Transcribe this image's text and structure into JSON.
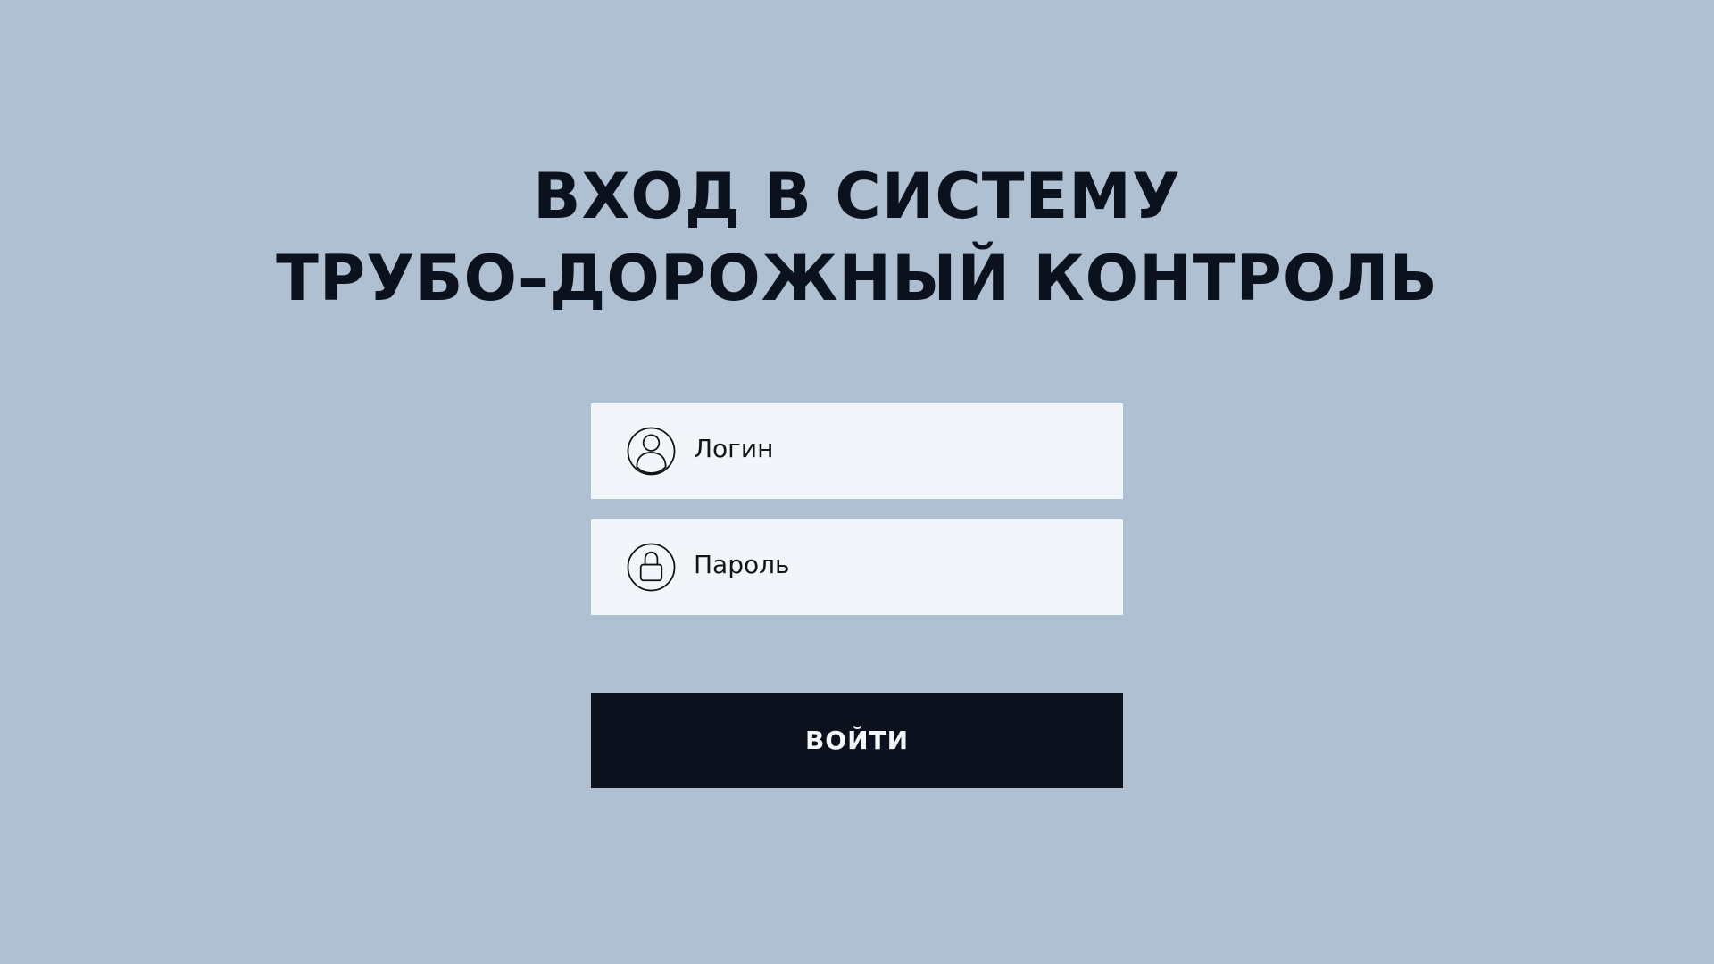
{
  "header": {
    "title_line1": "ВХОД В СИСТЕМУ",
    "title_line2": "ТРУБО–ДОРОЖНЫЙ КОНТРОЛЬ"
  },
  "login_form": {
    "login_field": {
      "placeholder": "Логин",
      "value": "",
      "icon": "user-icon"
    },
    "password_field": {
      "placeholder": "Пароль",
      "value": "",
      "icon": "lock-icon"
    },
    "submit_label": "ВОЙТИ"
  },
  "colors": {
    "background": "#aec0d1",
    "field_background": "#f2f6fb",
    "text_dark": "#0c121d",
    "button_background": "#0c121d",
    "button_text": "#f4f6f9"
  }
}
